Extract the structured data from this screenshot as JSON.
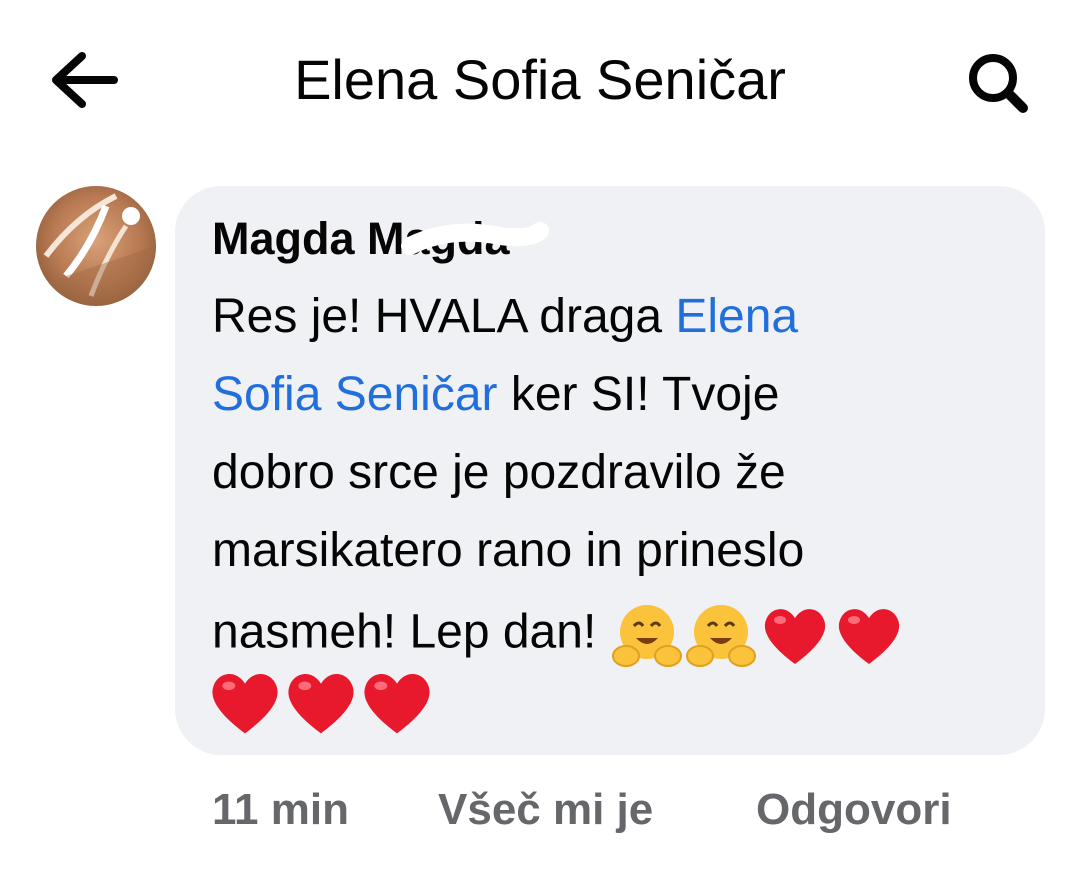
{
  "header": {
    "title": "Elena Sofia Seničar",
    "back_icon": "arrow-left-icon",
    "search_icon": "search-icon"
  },
  "comment": {
    "author": "Magda Magda",
    "avatar_icon": "avatar-photo",
    "text_part1": "Res je! HVALA draga ",
    "mention_line1": "Elena",
    "mention_line2": "Sofia Seničar",
    "text_part2": " ker SI! Tvoje",
    "line3": "dobro srce je pozdravilo že",
    "line4": "marsikatero rano in prineslo",
    "line5": "nasmeh! Lep dan!",
    "emojis": [
      "hugging-face-emoji",
      "hugging-face-emoji",
      "red-heart-emoji",
      "red-heart-emoji",
      "red-heart-emoji",
      "red-heart-emoji",
      "red-heart-emoji"
    ],
    "mention_color": "#216fdb",
    "bubble_color": "#f0f1f5"
  },
  "actions": {
    "time": "11 min",
    "like": "Všeč mi je",
    "reply": "Odgovori",
    "color": "#65676b"
  }
}
